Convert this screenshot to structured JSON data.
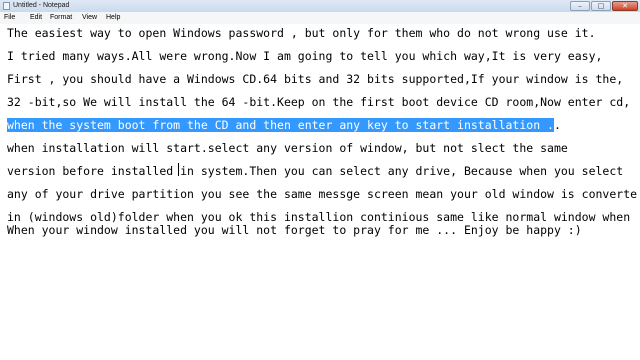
{
  "window": {
    "title": "Untitled - Notepad",
    "controls": {
      "minimize": "–",
      "maximize": "□",
      "close": "✕"
    }
  },
  "menu": {
    "items": [
      "File",
      "Edit",
      "Format",
      "View",
      "Help"
    ]
  },
  "editor": {
    "lines": [
      "The easiest way to open Windows password , but only for them who do not wrong use it.",
      "I tried many ways.All were wrong.Now I am going to tell you which way,It is very easy,",
      "First , you should have a Windows CD.64 bits and 32 bits supported,If your window is the,",
      "32 -bit,so We will install the 64 -bit.Keep on the first boot device CD room,Now enter cd,",
      "when the system boot from the CD and then enter any key to start installation .",
      ".",
      "when installation will start.select any version of window, but not slect the same",
      "version before installed in system.Then you can select any drive, Because when you select",
      "any of your drive partition you see the same messge screen mean your old window is converte",
      "in (windows old)folder when you ok this installion continious same like normal window when",
      "When your window installed you will not forget to pray for me ... Enjoy be happy :)"
    ]
  }
}
